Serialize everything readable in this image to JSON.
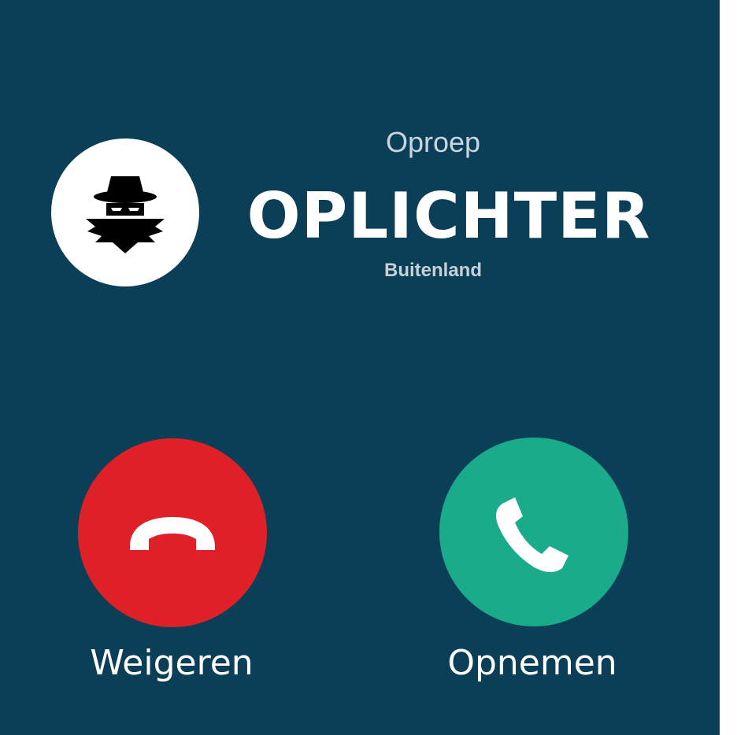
{
  "call": {
    "label": "Oproep",
    "caller_name": "OPLICHTER",
    "caller_location": "Buitenland",
    "avatar_icon": "spy-icon"
  },
  "actions": {
    "decline": {
      "label": "Weigeren",
      "icon": "phone-hangup-icon",
      "color": "#e02027"
    },
    "accept": {
      "label": "Opnemen",
      "icon": "phone-icon",
      "color": "#1aab8a"
    }
  },
  "colors": {
    "background": "#0b3f57",
    "text": "#ffffff"
  }
}
